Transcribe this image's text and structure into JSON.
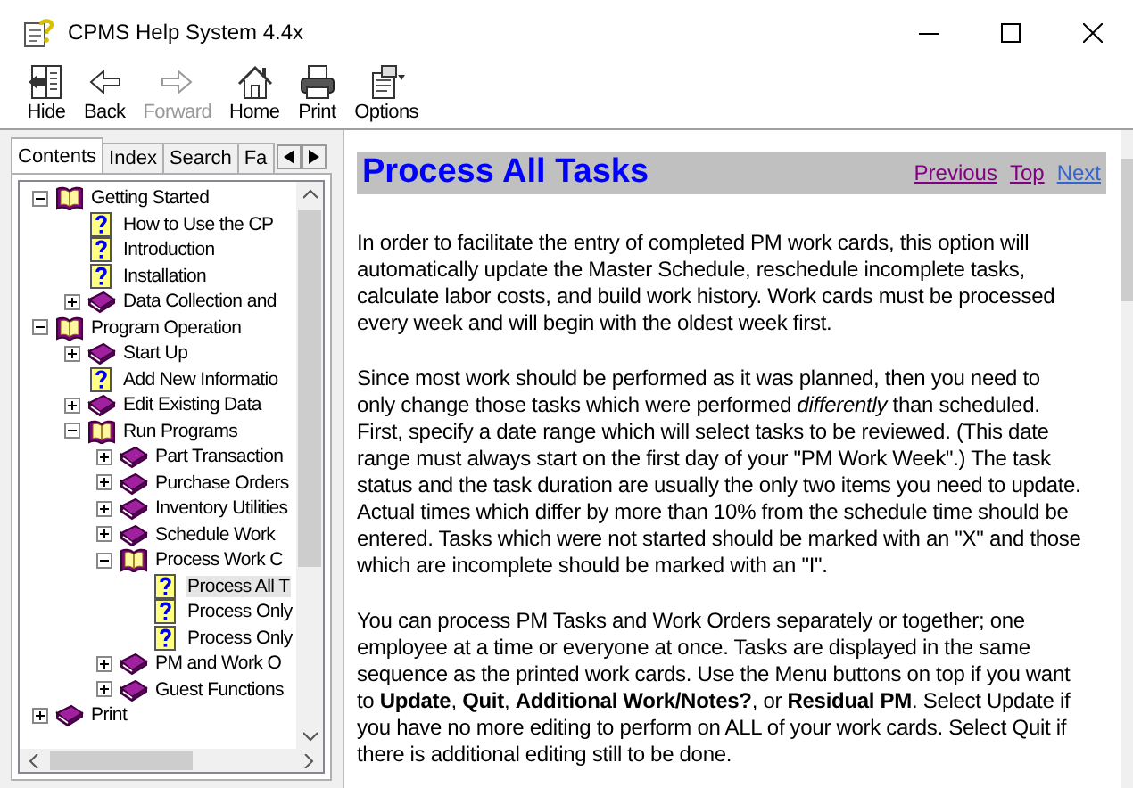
{
  "window": {
    "title": "CPMS Help System 4.4x"
  },
  "toolbar": [
    {
      "label": "Hide",
      "kind": "hide",
      "disabled": false
    },
    {
      "label": "Back",
      "kind": "back",
      "disabled": false
    },
    {
      "label": "Forward",
      "kind": "forward",
      "disabled": true
    },
    {
      "label": "Home",
      "kind": "home",
      "disabled": false
    },
    {
      "label": "Print",
      "kind": "print",
      "disabled": false
    },
    {
      "label": "Options",
      "kind": "options",
      "disabled": false
    }
  ],
  "nav_tabs": [
    {
      "label": "Contents",
      "selected": true
    },
    {
      "label": "Index",
      "selected": false
    },
    {
      "label": "Search",
      "selected": false
    },
    {
      "label": "Fa",
      "selected": false
    }
  ],
  "tree": [
    {
      "label": "Getting Started",
      "kind": "book",
      "expanded": true,
      "selected": false,
      "children": [
        {
          "label": "How to Use the CP",
          "kind": "page",
          "selected": false
        },
        {
          "label": "Introduction",
          "kind": "page",
          "selected": false
        },
        {
          "label": "Installation",
          "kind": "page",
          "selected": false
        },
        {
          "label": "Data Collection and",
          "kind": "book",
          "expanded": false,
          "selected": false
        }
      ]
    },
    {
      "label": "Program Operation",
      "kind": "book",
      "expanded": true,
      "selected": false,
      "children": [
        {
          "label": "Start Up",
          "kind": "book",
          "expanded": false,
          "selected": false
        },
        {
          "label": "Add New Informatio",
          "kind": "page",
          "selected": false
        },
        {
          "label": "Edit Existing Data",
          "kind": "book",
          "expanded": false,
          "selected": false
        },
        {
          "label": "Run Programs",
          "kind": "book",
          "expanded": true,
          "selected": false,
          "children": [
            {
              "label": "Part Transaction",
              "kind": "book",
              "expanded": false,
              "selected": false
            },
            {
              "label": "Purchase Orders",
              "kind": "book",
              "expanded": false,
              "selected": false
            },
            {
              "label": "Inventory Utilities",
              "kind": "book",
              "expanded": false,
              "selected": false
            },
            {
              "label": "Schedule Work",
              "kind": "book",
              "expanded": false,
              "selected": false
            },
            {
              "label": "Process Work C",
              "kind": "book",
              "expanded": true,
              "selected": false,
              "children": [
                {
                  "label": "Process All T",
                  "kind": "page",
                  "selected": true
                },
                {
                  "label": "Process Only",
                  "kind": "page",
                  "selected": false
                },
                {
                  "label": "Process Only",
                  "kind": "page",
                  "selected": false
                }
              ]
            },
            {
              "label": "PM and Work O",
              "kind": "book",
              "expanded": false,
              "selected": false
            },
            {
              "label": "Guest Functions",
              "kind": "book",
              "expanded": false,
              "selected": false
            }
          ]
        }
      ]
    },
    {
      "label": "Print",
      "kind": "book",
      "expanded": false,
      "selected": false
    }
  ],
  "topic": {
    "title": "Process All Tasks",
    "links": [
      {
        "label": "Previous",
        "visited": true
      },
      {
        "label": "Top",
        "visited": true
      },
      {
        "label": "Next",
        "visited": false
      }
    ],
    "paragraphs": [
      "In order to facilitate the entry of completed PM work cards, this option will automatically update the Master Schedule, reschedule incomplete tasks, calculate labor costs, and build work history. Work cards must be processed every week and will begin with the oldest week first.",
      "Since most work should be performed as it was planned, then you need to only change those tasks which were performed *differently* than scheduled. First, specify a date range which will select tasks to be reviewed. (This date range must always start on the first day of your \"PM Work Week\".) The task status and the task duration are usually the only two items you need to update. Actual times which differ by more than 10% from the schedule time should be entered. Tasks which were not started should be marked with an \"X\" and those which are incomplete should be marked with an \"I\".",
      "You can process PM Tasks and Work Orders separately or together; one employee at a time or everyone at once. Tasks are displayed in the same sequence as the printed work cards. Use the Menu buttons on top if you want to **Update**, **Quit**, **Additional Work/Notes?**, or **Residual PM**. Select Update if you have no more editing to perform on ALL of your work cards. Select Quit if there is additional editing still to be done."
    ]
  }
}
